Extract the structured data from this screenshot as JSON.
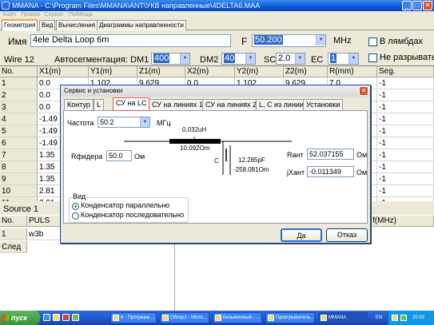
{
  "window": {
    "title": "MMANA - C:\\Program Files\\MMANA\\ANT\\УКВ направленные\\4DELTA6.MAA"
  },
  "menu": [
    "Файл",
    "Правка",
    "Сервис",
    "По/Мощь"
  ],
  "tabs": [
    "Геометрия",
    "Вид",
    "Вычисления",
    "Диаграммы направленности"
  ],
  "geometry": {
    "name_label": "Имя",
    "name_value": "4ele Delta Loop 6m",
    "freq_label": "F",
    "freq_value": "50.200",
    "freq_unit": "MHz",
    "wave_check": "В лямбдах",
    "nobreak_check": "Не разрывать",
    "wire_label": "Wire 12",
    "autoseg_label": "Автосегментация:",
    "dm1_label": "DM1",
    "dm1_value": "400",
    "dm2_label": "DM2",
    "dm2_value": "40",
    "sc_label": "SC",
    "sc_value": "2.0",
    "ec_label": "EC",
    "ec_value": "1"
  },
  "wire_table": {
    "headers": [
      "No.",
      "X1(m)",
      "Y1(m)",
      "Z1(m)",
      "X2(m)",
      "Y2(m)",
      "Z2(m)",
      "R(mm)",
      "Seg."
    ],
    "rows": [
      [
        "1",
        "0.0",
        "1.102",
        "9.629",
        "0.0",
        "1.102",
        "9.629",
        "7.0",
        "-1"
      ],
      [
        "2",
        "0.0",
        "",
        "",
        "",
        "",
        "",
        "",
        "-1"
      ],
      [
        "3",
        "0.0",
        "",
        "",
        "",
        "",
        "",
        "",
        "-1"
      ],
      [
        "4",
        "-1.49",
        "",
        "",
        "",
        "",
        "",
        "",
        "-1"
      ],
      [
        "5",
        "-1.49",
        "",
        "",
        "",
        "",
        "",
        "",
        "-1"
      ],
      [
        "6",
        "-1.49",
        "",
        "",
        "",
        "",
        "",
        "",
        "-1"
      ],
      [
        "7",
        "1.35",
        "",
        "",
        "",
        "",
        "",
        "",
        "-1"
      ],
      [
        "8",
        "1.35",
        "",
        "",
        "",
        "",
        "",
        "",
        "-1"
      ],
      [
        "9",
        "1.35",
        "",
        "",
        "",
        "",
        "",
        "",
        "-1"
      ],
      [
        "10",
        "2.81",
        "",
        "",
        "",
        "",
        "",
        "",
        "-1"
      ],
      [
        "11",
        "2.81",
        "",
        "",
        "",
        "",
        "",
        "",
        "-1"
      ]
    ]
  },
  "source": {
    "title": "Source 1",
    "headers": [
      "No.",
      "PULS"
    ],
    "rows": [
      [
        "1",
        "w3b"
      ]
    ],
    "next_label": "След",
    "right_header": "f(MHz)"
  },
  "dialog": {
    "title": "Сервис и установки",
    "tabs": [
      "Контур",
      "L",
      "СУ на LC",
      "СУ на линиях 1",
      "СУ на линиях 2",
      "L, C из линии",
      "Установки"
    ],
    "freq_label": "Частота",
    "freq_value": "50.2",
    "freq_unit": "МГц",
    "feeder_label": "Rфидера",
    "feeder_value": "50.0",
    "feeder_unit": "Ом",
    "l_value": "0.032uH",
    "l_label": "L",
    "l_reactance": "10.092Om",
    "c_label": "C",
    "c_value": "12.285pF",
    "c_reactance": "-258.081Om",
    "rant_label": "Rант",
    "rant_value": "52.037155",
    "rant_unit": "Ом",
    "xant_label": "jXант",
    "xant_value": "-0.011349",
    "xant_unit": "Ом",
    "view_label": "Вид",
    "radio_parallel": "Конденсатор параллельно",
    "radio_series": "Конденсатор последовательно",
    "ok_button": "Да",
    "cancel_button": "Отказ"
  },
  "taskbar": {
    "start": "пуск",
    "tasks": [
      "8 - Програма ...",
      "Обзор1 - Micro...",
      "Безымянный - ...",
      "Проигрыватель...",
      "MMANA"
    ],
    "lang": "EN",
    "time": "20:03"
  }
}
